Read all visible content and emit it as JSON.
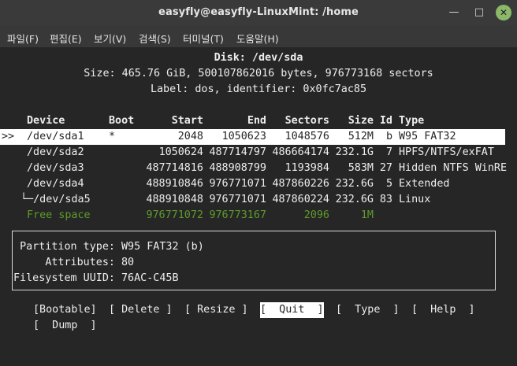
{
  "window": {
    "title": "easyfly@easyfly-LinuxMint: /home",
    "minimize_glyph": "—",
    "maximize_glyph": "□",
    "close_glyph": "✕"
  },
  "menu": [
    "파일(F)",
    "편집(E)",
    "보기(V)",
    "검색(S)",
    "터미널(T)",
    "도움말(H)"
  ],
  "header": {
    "disk": "Disk: /dev/sda",
    "size": "Size: 465.76 GiB, 500107862016 bytes, 976773168 sectors",
    "label": "Label: dos, identifier: 0x0fc7ac85"
  },
  "table": {
    "columns": [
      "Device",
      "Boot",
      "Start",
      "End",
      "Sectors",
      "Size",
      "Id",
      "Type"
    ],
    "selection_marker": ">>",
    "rows": [
      {
        "device": "/dev/sda1",
        "boot": "*",
        "start": "2048",
        "end": "1050623",
        "sectors": "1048576",
        "size": "512M",
        "id": "b",
        "type": "W95 FAT32",
        "selected": true
      },
      {
        "device": "/dev/sda2",
        "boot": "",
        "start": "1050624",
        "end": "487714797",
        "sectors": "486664174",
        "size": "232.1G",
        "id": "7",
        "type": "HPFS/NTFS/exFAT"
      },
      {
        "device": "/dev/sda3",
        "boot": "",
        "start": "487714816",
        "end": "488908799",
        "sectors": "1193984",
        "size": "583M",
        "id": "27",
        "type": "Hidden NTFS WinRE"
      },
      {
        "device": "/dev/sda4",
        "boot": "",
        "start": "488910846",
        "end": "976771071",
        "sectors": "487860226",
        "size": "232.6G",
        "id": "5",
        "type": "Extended"
      },
      {
        "device": "└─/dev/sda5",
        "boot": "",
        "start": "488910848",
        "end": "976771071",
        "sectors": "487860224",
        "size": "232.6G",
        "id": "83",
        "type": "Linux"
      },
      {
        "device": "Free space",
        "boot": "",
        "start": "976771072",
        "end": "976773167",
        "sectors": "2096",
        "size": "1M",
        "id": "",
        "type": "",
        "free": true
      }
    ]
  },
  "info": {
    "partition_type_label": "Partition type:",
    "partition_type": "W95 FAT32 (b)",
    "attributes_label": "Attributes:",
    "attributes": "80",
    "uuid_label": "Filesystem UUID:",
    "uuid": "76AC-C45B"
  },
  "actions": {
    "bootable": "[Bootable]",
    "delete": "[ Delete ]",
    "resize": "[ Resize ]",
    "quit": "[  Quit  ]",
    "type": "[  Type  ]",
    "help": "[  Help  ]",
    "dump": "[  Dump  ]",
    "selected": "quit"
  },
  "colors": {
    "free_space": "#5f9a2a",
    "selection_bg": "#ffffff",
    "terminal_bg": "#262626",
    "close_button": "#8cb86a"
  }
}
